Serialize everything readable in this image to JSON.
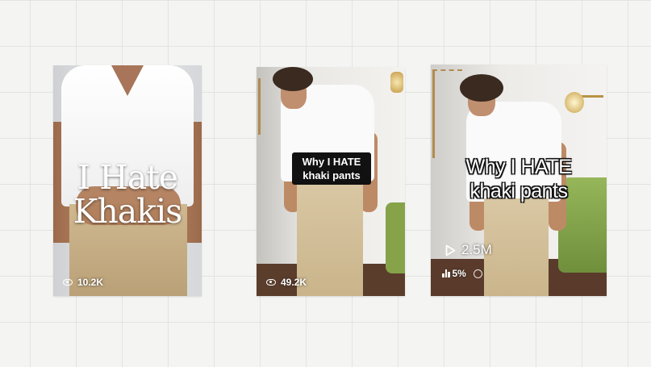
{
  "cards": [
    {
      "title": "I Hate\nKhakis",
      "views": "10.2K"
    },
    {
      "caption": "Why I HATE\nkhaki pants",
      "views": "49.2K"
    },
    {
      "caption": "Why I HATE\nkhaki pants",
      "plays": "2.5M",
      "percent": "5%"
    }
  ],
  "icons": {
    "views": "eye-icon",
    "plays": "play-icon",
    "stats": "bar-chart-icon",
    "info": "info-icon"
  }
}
